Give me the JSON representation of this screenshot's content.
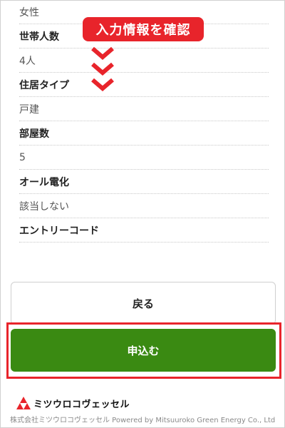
{
  "form_rows": [
    {
      "text": "女性",
      "kind": "value"
    },
    {
      "text": "世帯人数",
      "kind": "label"
    },
    {
      "text": "4人",
      "kind": "value"
    },
    {
      "text": "住居タイプ",
      "kind": "label"
    },
    {
      "text": "戸建",
      "kind": "value"
    },
    {
      "text": "部屋数",
      "kind": "label"
    },
    {
      "text": "5",
      "kind": "value"
    },
    {
      "text": "オール電化",
      "kind": "label"
    },
    {
      "text": "該当しない",
      "kind": "value"
    },
    {
      "text": "エントリーコード",
      "kind": "label"
    }
  ],
  "annotation": {
    "callout_text": "入力情報を確認",
    "color": "#e8242b"
  },
  "buttons": {
    "back_label": "戻る",
    "apply_label": "申込む",
    "apply_color": "#3a8a12"
  },
  "logo": {
    "text": "ミツウロコヴェッセル",
    "icon": "mitsuuroko-triangles-icon"
  },
  "footer": {
    "text": "株式会社ミツウロコヴェッセル Powered by Mitsuuroko Green Energy Co., Ltd"
  }
}
